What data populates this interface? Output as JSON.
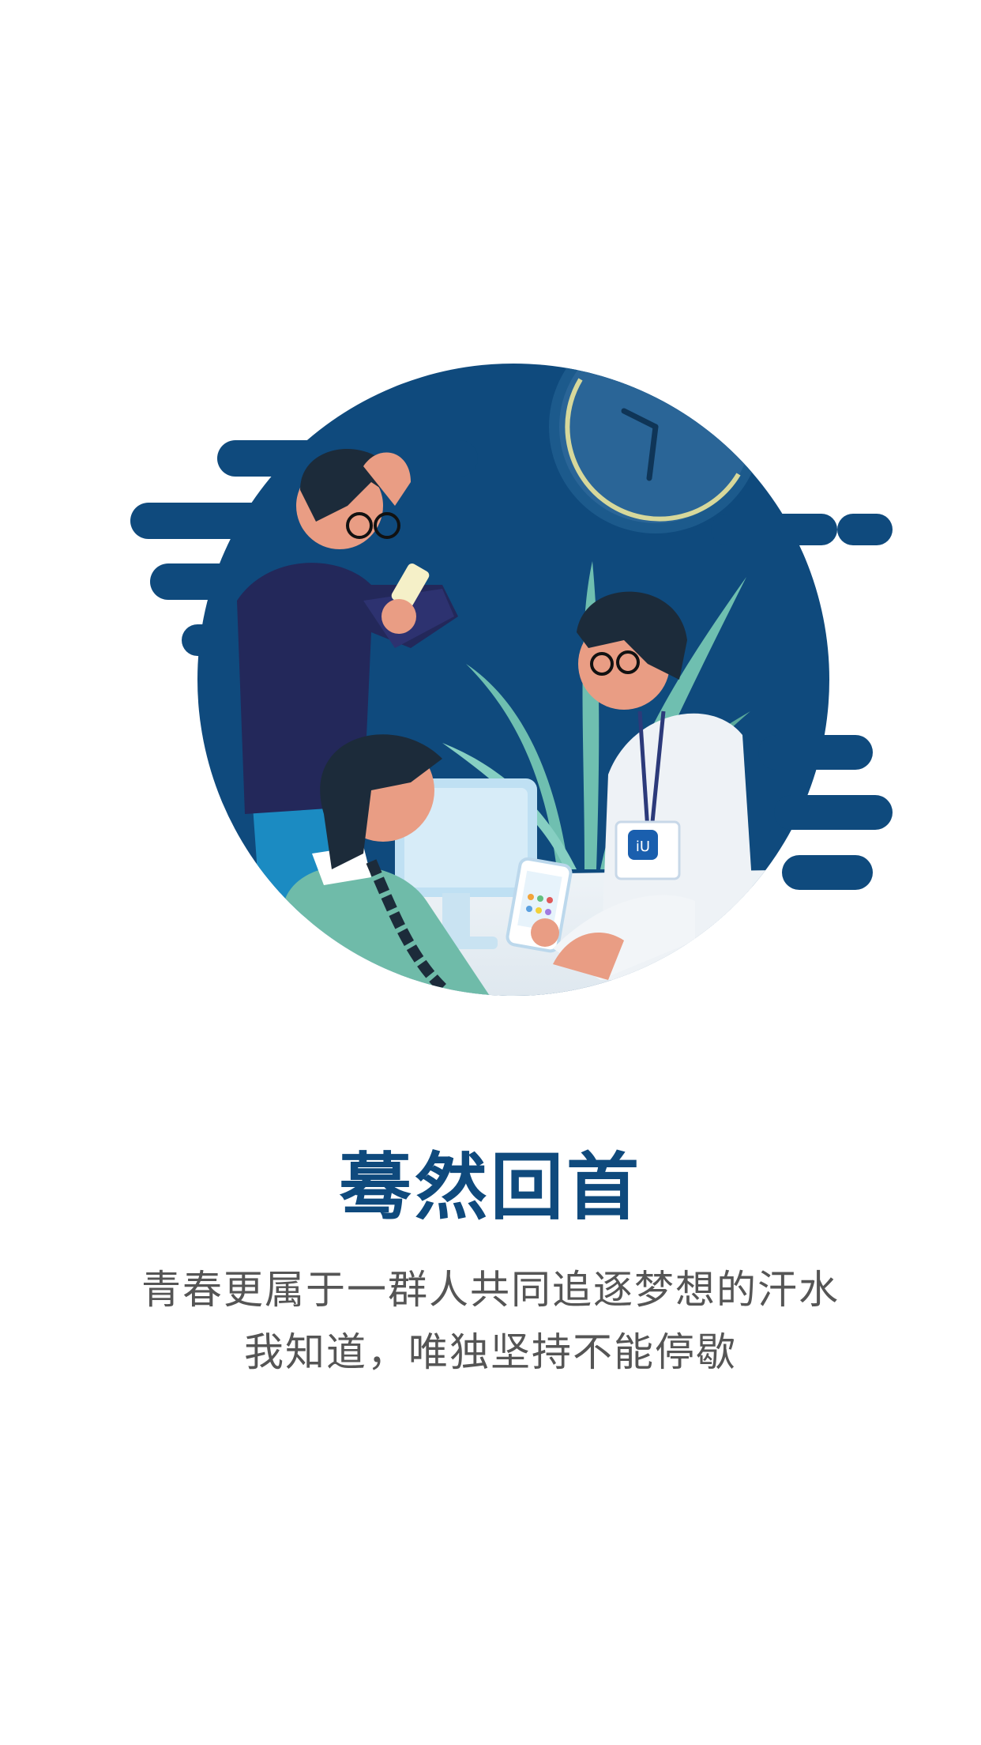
{
  "intro": {
    "title": "蓦然回首",
    "lines": [
      "青春更属于一群人共同追逐梦想的汗水",
      "我知道，唯独坚持不能停歇"
    ]
  },
  "illustration": {
    "badge_text": "iU"
  },
  "colors": {
    "title": "#0f4a7d",
    "body_text": "#555555",
    "circle": "#0f4a7d",
    "background": "#ffffff"
  }
}
